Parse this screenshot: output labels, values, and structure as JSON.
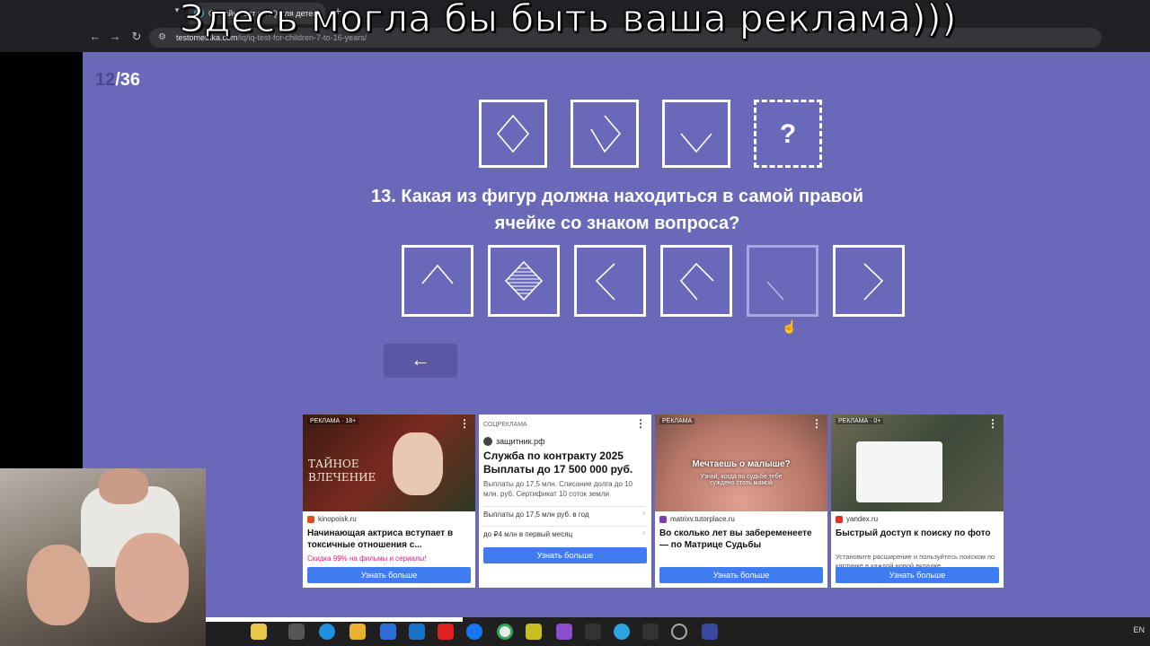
{
  "browser": {
    "tab_title": "Онлайн тест на IQ для детей",
    "tab_close": "×",
    "new_tab": "+",
    "url_host": "testometrika.com",
    "url_path": "/iq/iq-test-for-children-7-to-16-years/",
    "back": "←",
    "forward": "→",
    "reload": "↻"
  },
  "overlay_banner": "Здесь могла бы быть ваша реклама)))",
  "test": {
    "progress_current": "12",
    "progress_total": "/36",
    "question_mark": "?",
    "question": "13. Какая из фигур должна находиться в самой правой ячейке со знаком вопроса?",
    "back_arrow": "←",
    "sequence_icons": [
      "diamond-icon",
      "chevron-right-down-icon",
      "chevron-down-icon",
      "question-icon"
    ],
    "option_icons": [
      "chevron-up-icon",
      "striped-diamond-icon",
      "chevron-left-icon",
      "chevron-up-left-icon",
      "slash-icon",
      "chevron-right-icon"
    ]
  },
  "ads": [
    {
      "tag": "РЕКЛАМА · 18+",
      "image_text": "ТАЙНОЕ ВЛЕЧЕНИЕ",
      "domain": "kinopoisk.ru",
      "title": "Начинающая актриса вступает в токсичные отношения с...",
      "promo": "Скидка 99% на фильмы и сериалы!",
      "button": "Узнать больше"
    },
    {
      "tag": "СОЦРЕКЛАМА",
      "domain": "защитник.рф",
      "title": "Служба по контракту 2025 Выплаты до 17 500 000 руб.",
      "description": "Выплаты до 17,5 млн. Списание долга до 10 млн. руб. Сертификат 10 соток земли",
      "row1": "Выплаты до 17,5 млн руб. в год",
      "row2": "до ₽4 млн в первый месяц",
      "button": "Узнать больше"
    },
    {
      "tag": "РЕКЛАМА",
      "image_text": "Мечтаешь о малыше?",
      "image_sub": "Узнай, когда по судьбе тебе суждено стать мамой",
      "domain": "matrixv.tutorplace.ru",
      "title": "Во сколько лет вы забеременеете — по Матрице Судьбы",
      "button": "Узнать больше"
    },
    {
      "tag": "РЕКЛАМА · 0+",
      "domain": "yandex.ru",
      "title": "Быстрый доступ к поиску по фото",
      "description": "Установите расширение и пользуйтесь поиском по картинке в каждой новой вкладке",
      "button": "Узнать больше"
    }
  ],
  "ad_menu": "⋮",
  "tray_text": "EN"
}
